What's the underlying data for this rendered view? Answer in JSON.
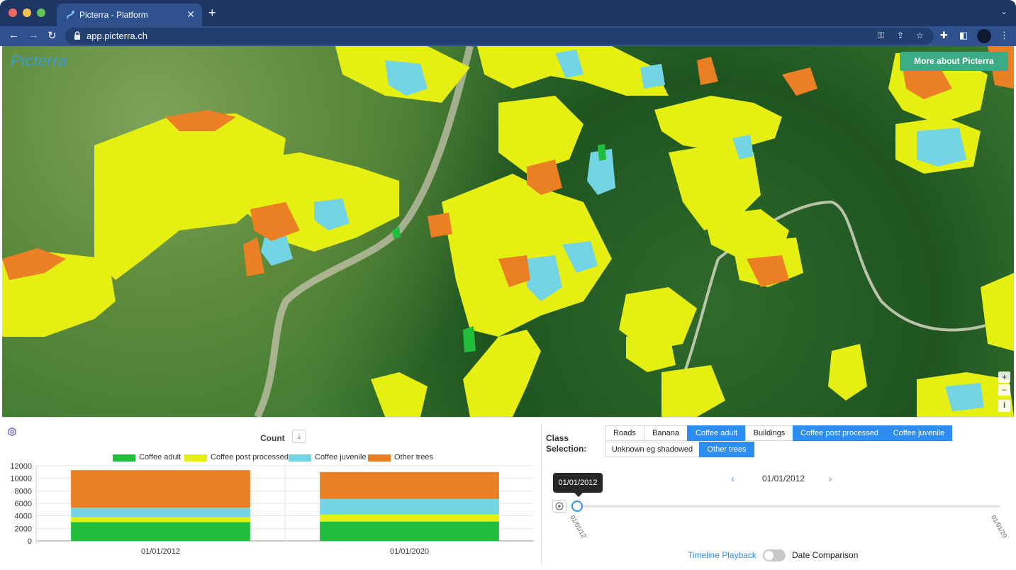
{
  "browser": {
    "tab_title": "Picterra - Platform",
    "close_glyph": "✕",
    "new_tab_glyph": "+",
    "url": "app.picterra.ch",
    "colors": {
      "titlebar": "#1f3564",
      "toolbar": "#2f528f"
    }
  },
  "map": {
    "logo_text": "Picterra",
    "more_button": "More about Picterra",
    "zoom_in": "+",
    "zoom_out": "−",
    "info": "i",
    "class_colors": {
      "Coffee adult": "#1fbe3c",
      "Coffee post processed": "#e5ef12",
      "Coffee juvenile": "#73d4e4",
      "Other trees": "#ea7f23"
    }
  },
  "chart_panel": {
    "title": "Count",
    "download_icon": "⤓"
  },
  "chart_data": {
    "type": "bar",
    "stacked": true,
    "categories": [
      "01/01/2012",
      "01/01/2020"
    ],
    "series": [
      {
        "name": "Coffee adult",
        "color": "#1fbe3c",
        "values": [
          3000,
          3100
        ]
      },
      {
        "name": "Coffee post processed",
        "color": "#e5ef12",
        "values": [
          800,
          1100
        ]
      },
      {
        "name": "Coffee juvenile",
        "color": "#73d4e4",
        "values": [
          1500,
          2500
        ]
      },
      {
        "name": "Other trees",
        "color": "#ea7f23",
        "values": [
          6000,
          4300
        ]
      }
    ],
    "ylim": [
      0,
      12000
    ],
    "yticks": [
      "12000",
      "10000",
      "8000",
      "6000",
      "4000",
      "2000",
      "0"
    ],
    "legend": "top"
  },
  "class_selection": {
    "label_line1": "Class",
    "label_line2": "Selection:",
    "chips": [
      {
        "label": "Roads",
        "active": false
      },
      {
        "label": "Banana",
        "active": false
      },
      {
        "label": "Coffee adult",
        "active": true
      },
      {
        "label": "Buildings",
        "active": false
      },
      {
        "label": "Coffee post processed",
        "active": true
      },
      {
        "label": "Coffee juvenile",
        "active": true
      },
      {
        "label": "Unknown eg shadowed",
        "active": false
      },
      {
        "label": "Other trees",
        "active": true
      }
    ]
  },
  "timeline": {
    "prev_glyph": "‹",
    "next_glyph": "›",
    "current_date": "01/01/2012",
    "tooltip": "01/01/2012",
    "start_tick": "01/01/12",
    "end_tick": "01/01/20",
    "playback_label": "Timeline Playback",
    "comparison_label": "Date Comparison",
    "comparison_on": false
  }
}
